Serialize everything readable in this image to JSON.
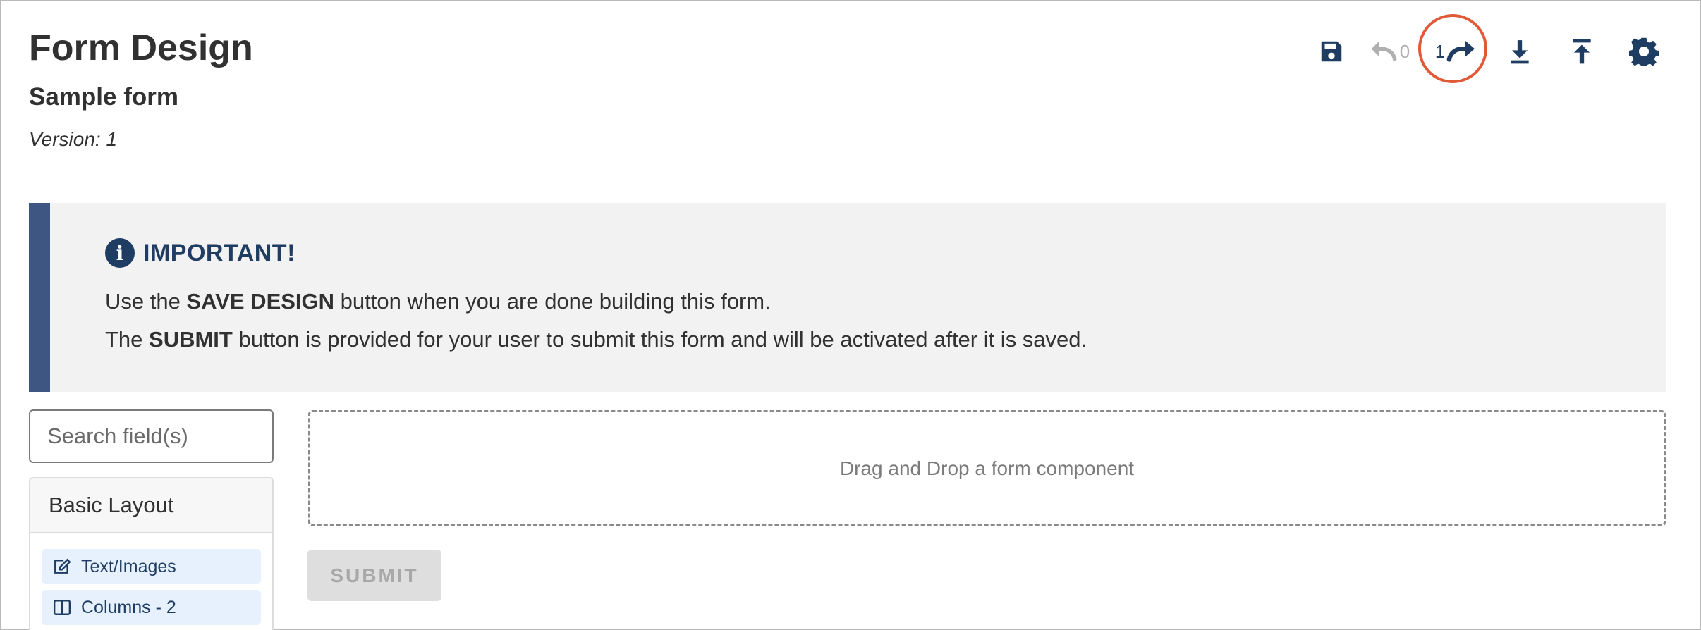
{
  "header": {
    "title": "Form Design",
    "form_name": "Sample form",
    "version_label": "Version: 1"
  },
  "toolbar": {
    "save_icon": "save-icon",
    "undo_icon": "undo-icon",
    "undo_count": "0",
    "redo_icon": "redo-icon",
    "redo_count": "1",
    "download_icon": "download-icon",
    "upload_icon": "upload-icon",
    "settings_icon": "gear-icon",
    "undo_color": "#b0b0b0",
    "icon_color": "#1f3d63",
    "highlight_color": "#e05a38"
  },
  "notice": {
    "title": "IMPORTANT!",
    "line1_before": "Use the ",
    "line1_bold": "SAVE DESIGN",
    "line1_after": " button when you are done building this form.",
    "line2_before": "The ",
    "line2_bold": "SUBMIT",
    "line2_after": " button is provided for your user to submit this form and will be activated after it is saved.",
    "accent_color": "#3d5682"
  },
  "sidebar": {
    "search_placeholder": "Search field(s)",
    "group_title": "Basic Layout",
    "items": [
      {
        "label": "Text/Images",
        "icon": "edit-icon"
      },
      {
        "label": "Columns - 2",
        "icon": "columns-icon"
      }
    ]
  },
  "canvas": {
    "dropzone_text": "Drag and Drop a form component",
    "submit_label": "SUBMIT"
  }
}
